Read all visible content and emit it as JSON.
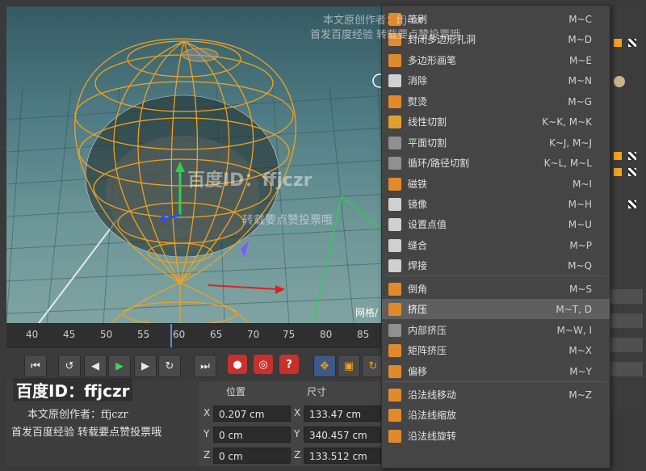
{
  "viewport": {
    "mode_label": "网格/"
  },
  "timeline": {
    "ticks": [
      "40",
      "45",
      "50",
      "55",
      "60",
      "65",
      "70",
      "75",
      "80",
      "85"
    ]
  },
  "playbar": {
    "buttons": [
      "|◀",
      "↺",
      "◀|",
      "▶",
      "|▶",
      "↻",
      "▶|"
    ]
  },
  "attributes": {
    "headers": {
      "position": "位置",
      "size": "尺寸"
    },
    "rows": [
      {
        "axis": "X",
        "position": "0.207 cm",
        "size_axis": "X",
        "size": "133.47 cm"
      },
      {
        "axis": "Y",
        "position": "0 cm",
        "size_axis": "Y",
        "size": "340.457 cm"
      },
      {
        "axis": "Z",
        "position": "0 cm",
        "size_axis": "Z",
        "size": "133.512 cm"
      }
    ]
  },
  "menu": {
    "items": [
      {
        "label": "笔刷",
        "shortcut": "M~C",
        "icon": "brush-icon",
        "color": "#e08a2c"
      },
      {
        "label": "封闭多边形孔洞",
        "shortcut": "M~D",
        "icon": "close-hole-icon",
        "color": "#e08a2c"
      },
      {
        "label": "多边形画笔",
        "shortcut": "M~E",
        "icon": "polygon-pen-icon",
        "color": "#e08a2c"
      },
      {
        "label": "消除",
        "shortcut": "M~N",
        "icon": "dissolve-icon",
        "color": "#d0d0d0"
      },
      {
        "label": "熨烫",
        "shortcut": "M~G",
        "icon": "iron-icon",
        "color": "#e08a2c"
      },
      {
        "label": "线性切割",
        "shortcut": "K~K, M~K",
        "icon": "line-cut-icon",
        "color": "#e0a030"
      },
      {
        "label": "平面切割",
        "shortcut": "K~J, M~J",
        "icon": "plane-cut-icon",
        "color": "#909090"
      },
      {
        "label": "循环/路径切割",
        "shortcut": "K~L, M~L",
        "icon": "loop-cut-icon",
        "color": "#909090"
      },
      {
        "label": "磁铁",
        "shortcut": "M~I",
        "icon": "magnet-icon",
        "color": "#e08a2c"
      },
      {
        "label": "镜像",
        "shortcut": "M~H",
        "icon": "mirror-icon",
        "color": "#d0d0d0"
      },
      {
        "label": "设置点值",
        "shortcut": "M~U",
        "icon": "set-point-icon",
        "color": "#d0d0d0"
      },
      {
        "label": "缝合",
        "shortcut": "M~P",
        "icon": "stitch-icon",
        "color": "#d0d0d0"
      },
      {
        "label": "焊接",
        "shortcut": "M~Q",
        "icon": "weld-icon",
        "color": "#d0d0d0"
      },
      {
        "label": "倒角",
        "shortcut": "M~S",
        "icon": "bevel-icon",
        "color": "#e08a2c"
      },
      {
        "label": "挤压",
        "shortcut": "M~T, D",
        "icon": "extrude-icon",
        "color": "#e08a2c",
        "highlighted": true
      },
      {
        "label": "内部挤压",
        "shortcut": "M~W, I",
        "icon": "extrude-inner-icon",
        "color": "#909090"
      },
      {
        "label": "矩阵挤压",
        "shortcut": "M~X",
        "icon": "matrix-extrude-icon",
        "color": "#e08a2c"
      },
      {
        "label": "偏移",
        "shortcut": "M~Y",
        "icon": "smooth-shift-icon",
        "color": "#e08a2c"
      },
      {
        "label": "沿法线移动",
        "shortcut": "M~Z",
        "icon": "normal-move-icon",
        "color": "#e08a2c"
      },
      {
        "label": "沿法线缩放",
        "shortcut": "",
        "icon": "normal-scale-icon",
        "color": "#e08a2c"
      },
      {
        "label": "沿法线旋转",
        "shortcut": "",
        "icon": "normal-rotate-icon",
        "color": "#e08a2c"
      }
    ]
  },
  "watermarks": {
    "top_line1": "本文原创作者：ffjczr",
    "top_line2": "首发百度经验  转载要点赞投票哦",
    "mid_id": "百度ID：ffjczr",
    "mid_line": "转载要点赞投票哦",
    "bl_id": "百度ID：ffjczr",
    "bl_line1": "本文原创作者：ffjczr",
    "bl_line2": "首发百度经验  转载要点赞投票哦"
  }
}
